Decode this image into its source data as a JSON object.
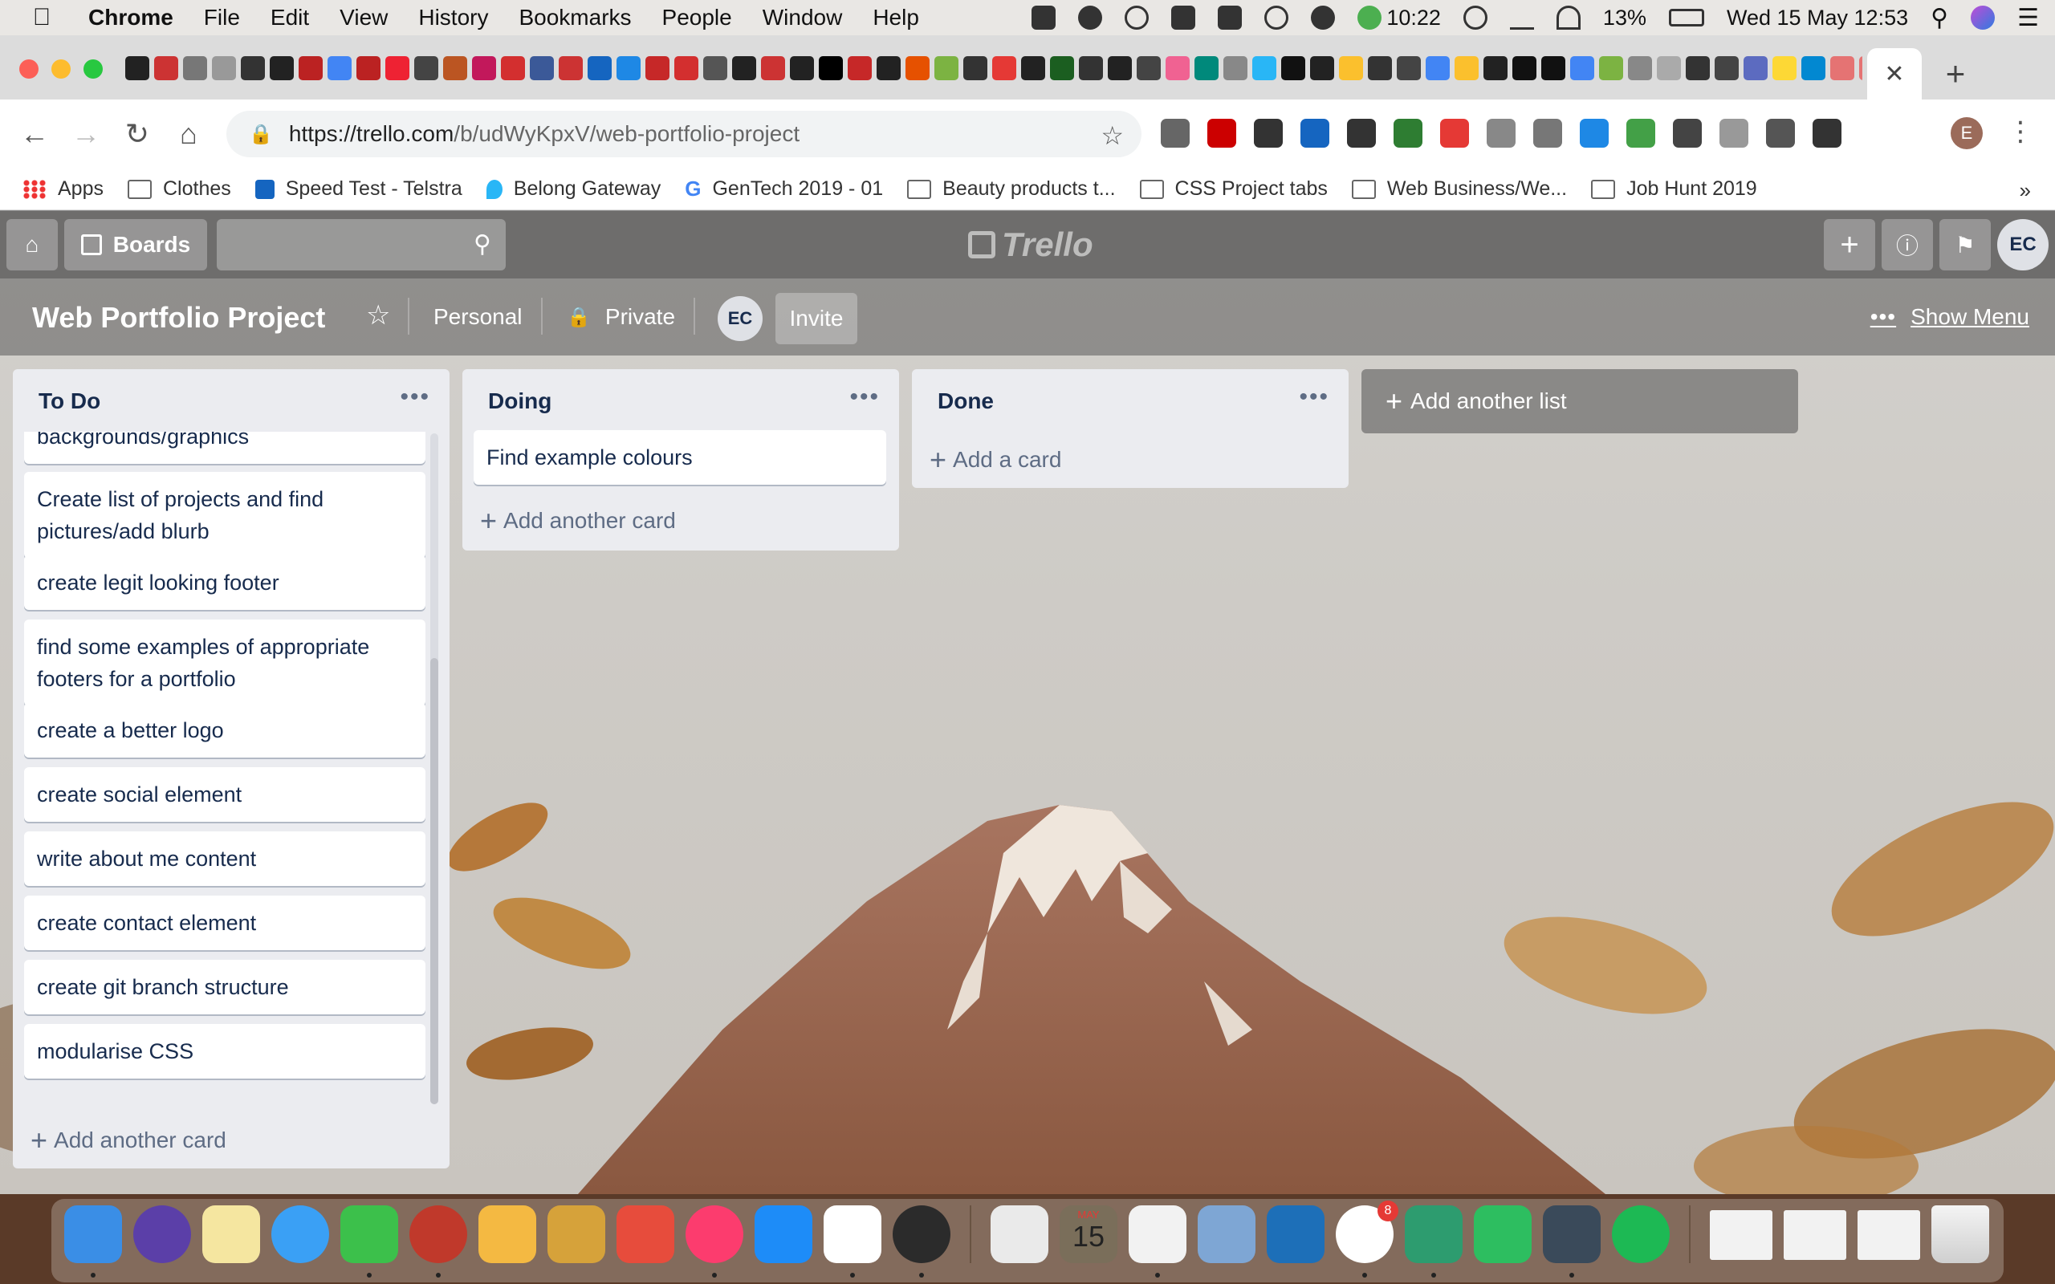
{
  "menubar": {
    "app_name": "Chrome",
    "items": [
      "File",
      "Edit",
      "View",
      "History",
      "Bookmarks",
      "People",
      "Window",
      "Help"
    ],
    "timer": "10:22",
    "battery": "13%",
    "datetime": "Wed 15 May  12:53"
  },
  "browser": {
    "url_domain": "https://trello.com",
    "url_path": "/b/udWyKpxV/web-portfolio-project",
    "close_tab_glyph": "✕",
    "new_tab_glyph": "+",
    "profile_initial": "E",
    "bookmarks": [
      "Apps",
      "Clothes",
      "Speed Test - Telstra",
      "Belong Gateway",
      "GenTech 2019 - 01",
      "Beauty products t...",
      "CSS Project tabs",
      "Web Business/We...",
      "Job Hunt 2019"
    ],
    "bookmarks_more": "»",
    "favicon_colors": [
      "#222",
      "#c33",
      "#777",
      "#999",
      "#333",
      "#222",
      "#b22",
      "#4285f4",
      "#b22",
      "#e23",
      "#444",
      "#b52",
      "#c2185b",
      "#d32f2f",
      "#3b5998",
      "#c33",
      "#1565c0",
      "#1e88e5",
      "#c62828",
      "#d32f2f",
      "#555",
      "#222",
      "#c33",
      "#222",
      "#000",
      "#c62828",
      "#222",
      "#e65100",
      "#7cb342",
      "#333",
      "#e53935",
      "#222",
      "#1b5e20",
      "#333",
      "#222",
      "#444",
      "#f06292",
      "#00897b",
      "#888",
      "#29b6f6",
      "#111",
      "#222",
      "#fbc02d",
      "#333",
      "#444",
      "#4285f4",
      "#fbc02d",
      "#222",
      "#111",
      "#111",
      "#4285f4",
      "#7cb342",
      "#888",
      "#aaa",
      "#333",
      "#444",
      "#5c6bc0",
      "#fdd835",
      "#0288d1",
      "#e57373",
      "#e57373",
      "#e57373",
      "#6a1b9a",
      "#222",
      "#222",
      "#444",
      "#7cb342",
      "#222",
      "#e91e63"
    ],
    "ext_colors": [
      "#666",
      "#c00",
      "#333",
      "#1565c0",
      "#333",
      "#2e7d32",
      "#e53935",
      "#888",
      "#777",
      "#1e88e5",
      "#43a047",
      "#444",
      "#999",
      "#555",
      "#333"
    ]
  },
  "trello": {
    "boards_label": "Boards",
    "logo_text": "Trello",
    "user_initials": "EC",
    "board_title": "Web Portfolio Project",
    "team": "Personal",
    "visibility": "Private",
    "member_initials": "EC",
    "invite_label": "Invite",
    "show_menu_label": "Show Menu",
    "add_list_label": "Add another list",
    "lists": [
      {
        "title": "To Do",
        "cards": [
          "backgrounds/graphics",
          "Create list of projects and find pictures/add blurb",
          "create legit looking footer",
          "find some examples of appropriate footers for a portfolio",
          "create a better logo",
          "create social element",
          "write about me content",
          "create contact element",
          "create git branch structure",
          "modularise CSS"
        ],
        "add_card_label": "Add another card"
      },
      {
        "title": "Doing",
        "cards": [
          "Find example colours"
        ],
        "add_card_label": "Add another card"
      },
      {
        "title": "Done",
        "cards": [],
        "add_card_label": "Add a card"
      }
    ]
  },
  "dock": {
    "calendar_month": "MAY",
    "calendar_day": "15",
    "slack_badge": "8",
    "app_colors": [
      "#3a8ee6",
      "#5b3fa8",
      "#f5e6a0",
      "#3aa0f5",
      "#3cc04b",
      "#c0392b",
      "#f4b942",
      "#d6a23a",
      "#e74c3c",
      "#fc3c6e",
      "#1d8cf8",
      "#fff",
      "#2b2b2b",
      "#eaeaea",
      "#7a6e5a",
      "#f2f2f2",
      "#7ea6d4",
      "#1d6fb8",
      "#ffffff",
      "#2d9c6f",
      "#2dbe60",
      "#3a4a5a",
      "#1db954"
    ]
  }
}
